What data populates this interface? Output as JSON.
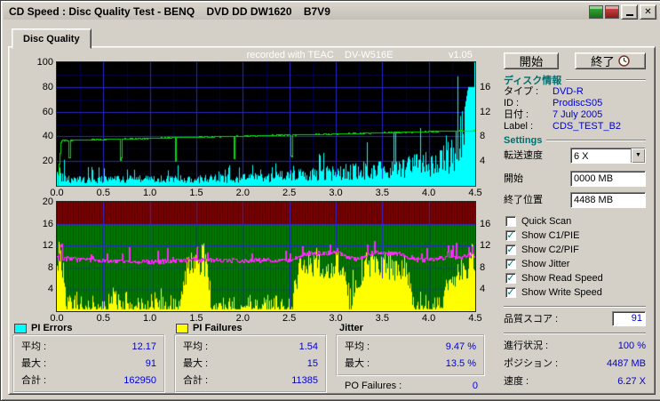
{
  "window": {
    "title": "CD Speed : Disc Quality Test - BENQ    DVD DD DW1620    B7V9",
    "tab": "Disc Quality"
  },
  "chart_header": {
    "recorded": "recorded with TEAC    DV-W516E",
    "version": "v1.05"
  },
  "buttons": {
    "start": "開始",
    "exit": "終了"
  },
  "disc_info": {
    "header": "ディスク情報",
    "rows": [
      {
        "label": "タイプ :",
        "value": "DVD-R"
      },
      {
        "label": "ID :",
        "value": "ProdiscS05"
      },
      {
        "label": "日付 :",
        "value": "7 July 2005"
      },
      {
        "label": "Label :",
        "value": "CDS_TEST_B2"
      }
    ]
  },
  "settings": {
    "header": "Settings",
    "speed_label": "転送速度",
    "speed_value": "6 X",
    "start_label": "開始",
    "start_value": "0000 MB",
    "end_label": "終了位置",
    "end_value": "4488 MB",
    "checkboxes": [
      {
        "label": "Quick Scan",
        "checked": false
      },
      {
        "label": "Show C1/PIE",
        "checked": true
      },
      {
        "label": "Show C2/PIF",
        "checked": true
      },
      {
        "label": "Show Jitter",
        "checked": true
      },
      {
        "label": "Show Read Speed",
        "checked": true
      },
      {
        "label": "Show Write Speed",
        "checked": true
      }
    ]
  },
  "score": {
    "label": "品質スコア :",
    "value": "91"
  },
  "status": {
    "rows": [
      {
        "label": "進行状況 :",
        "value": "100 %"
      },
      {
        "label": "ポジション :",
        "value": "4487 MB"
      },
      {
        "label": "速度 :",
        "value": "6.27 X"
      }
    ]
  },
  "stats": {
    "pi_errors": {
      "title": "PI Errors",
      "swatch": "#00ffff",
      "rows": [
        {
          "label": "平均 :",
          "value": "12.17"
        },
        {
          "label": "最大 :",
          "value": "91"
        },
        {
          "label": "合計 :",
          "value": "162950"
        }
      ]
    },
    "pi_failures": {
      "title": "PI Failures",
      "swatch": "#ffff00",
      "rows": [
        {
          "label": "平均 :",
          "value": "1.54"
        },
        {
          "label": "最大 :",
          "value": "15"
        },
        {
          "label": "合計 :",
          "value": "11385"
        }
      ]
    },
    "jitter": {
      "title": "Jitter",
      "rows": [
        {
          "label": "平均 :",
          "value": "9.47 %"
        },
        {
          "label": "最大 :",
          "value": "13.5 %"
        }
      ]
    },
    "po_failures": {
      "label": "PO Failures :",
      "value": "0"
    }
  },
  "chart_data": [
    {
      "type": "area",
      "title": "PI Errors (C1/PIE) and write speed vs disc capacity (GB)",
      "x_range": [
        0,
        4.5
      ],
      "x_tick_labels": [
        "0.0",
        "0.5",
        "1.0",
        "1.5",
        "2.0",
        "2.5",
        "3.0",
        "3.5",
        "4.0",
        "4.5"
      ],
      "y_left_range": [
        0,
        100
      ],
      "y_left_ticks": [
        100,
        80,
        60,
        40,
        20
      ],
      "y_right_range": [
        0,
        20
      ],
      "y_right_ticks": [
        16,
        12,
        8,
        4
      ],
      "series": [
        {
          "name": "PI Errors (C1/PIE)",
          "color": "#00ffff",
          "average": 12.17,
          "max": 91,
          "total": 162950,
          "envelope": [
            [
              0,
              20
            ],
            [
              0.05,
              12
            ],
            [
              0.15,
              8
            ],
            [
              0.5,
              8
            ],
            [
              1,
              9
            ],
            [
              1.5,
              9
            ],
            [
              2,
              10
            ],
            [
              2.3,
              11
            ],
            [
              2.5,
              13
            ],
            [
              2.8,
              15
            ],
            [
              3,
              17
            ],
            [
              3.2,
              19
            ],
            [
              3.5,
              21
            ],
            [
              3.8,
              25
            ],
            [
              4,
              28
            ],
            [
              4.15,
              33
            ],
            [
              4.25,
              40
            ],
            [
              4.35,
              60
            ],
            [
              4.42,
              100
            ],
            [
              4.5,
              100
            ]
          ]
        },
        {
          "name": "Write Speed (X)",
          "color": "#00dc00",
          "start_value": 7.4,
          "end_value": 9.0,
          "dips": [
            0.13,
            0.68,
            1.27,
            1.9,
            2.52
          ]
        }
      ]
    },
    {
      "type": "bar+line",
      "title": "PI Failures (C2/PIF) and Jitter vs disc capacity (GB)",
      "x_range": [
        0,
        4.5
      ],
      "x_tick_labels": [
        "0.0",
        "0.5",
        "1.0",
        "1.5",
        "2.0",
        "2.5",
        "3.0",
        "3.5",
        "4.0",
        "4.5"
      ],
      "y_range": [
        0,
        20
      ],
      "y_left_ticks": [
        20,
        16,
        12,
        8,
        4
      ],
      "y_right_ticks": [
        16,
        12,
        8,
        4
      ],
      "danger_zone_from": 16,
      "series": [
        {
          "name": "PI Failures (C2/PIF)",
          "color": "#ffff00",
          "average": 1.54,
          "max": 15,
          "total": 11385,
          "envelope": [
            [
              0,
              14
            ],
            [
              0.06,
              12
            ],
            [
              0.1,
              2
            ],
            [
              0.38,
              2.5
            ],
            [
              0.45,
              3
            ],
            [
              1.3,
              2
            ],
            [
              1.42,
              12
            ],
            [
              1.58,
              13
            ],
            [
              1.68,
              2
            ],
            [
              2.5,
              2
            ],
            [
              2.62,
              11
            ],
            [
              2.9,
              12
            ],
            [
              3.05,
              11
            ],
            [
              3.15,
              3
            ],
            [
              3.3,
              11
            ],
            [
              3.6,
              11
            ],
            [
              3.75,
              10
            ],
            [
              3.85,
              2
            ],
            [
              4.05,
              2
            ],
            [
              4.18,
              6
            ],
            [
              4.32,
              9
            ],
            [
              4.45,
              13
            ],
            [
              4.5,
              12
            ]
          ]
        },
        {
          "name": "Jitter (%)",
          "color": "#ff28ff",
          "average": 9.47,
          "max": 13.5,
          "envelope": [
            [
              0,
              9.8
            ],
            [
              0.5,
              9.2
            ],
            [
              1,
              9.1
            ],
            [
              1.5,
              9.5
            ],
            [
              2,
              9.3
            ],
            [
              2.5,
              9.5
            ],
            [
              2.7,
              10.6
            ],
            [
              3,
              10.8
            ],
            [
              3.2,
              9.6
            ],
            [
              3.4,
              10.8
            ],
            [
              3.7,
              10.5
            ],
            [
              3.9,
              9.4
            ],
            [
              4.2,
              9.8
            ],
            [
              4.5,
              10.3
            ]
          ]
        }
      ]
    }
  ]
}
